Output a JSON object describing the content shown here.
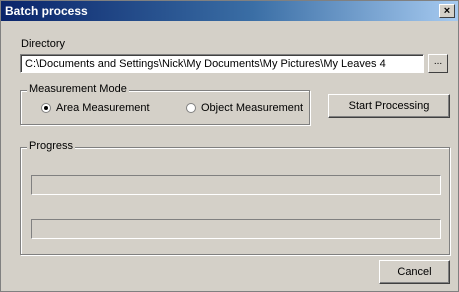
{
  "window": {
    "title": "Batch process",
    "close_glyph": "×"
  },
  "directory": {
    "label": "Directory",
    "value": "C:\\Documents and Settings\\Nick\\My Documents\\My Pictures\\My Leaves 4",
    "browse_label": "..."
  },
  "measurement_mode": {
    "title": "Measurement Mode",
    "options": [
      {
        "label": "Area Measurement",
        "selected": true
      },
      {
        "label": "Object Measurement",
        "selected": false
      }
    ]
  },
  "start_button": {
    "label": "Start Processing"
  },
  "progress": {
    "title": "Progress",
    "bar1": 0,
    "bar2": 0
  },
  "cancel_button": {
    "label": "Cancel"
  }
}
